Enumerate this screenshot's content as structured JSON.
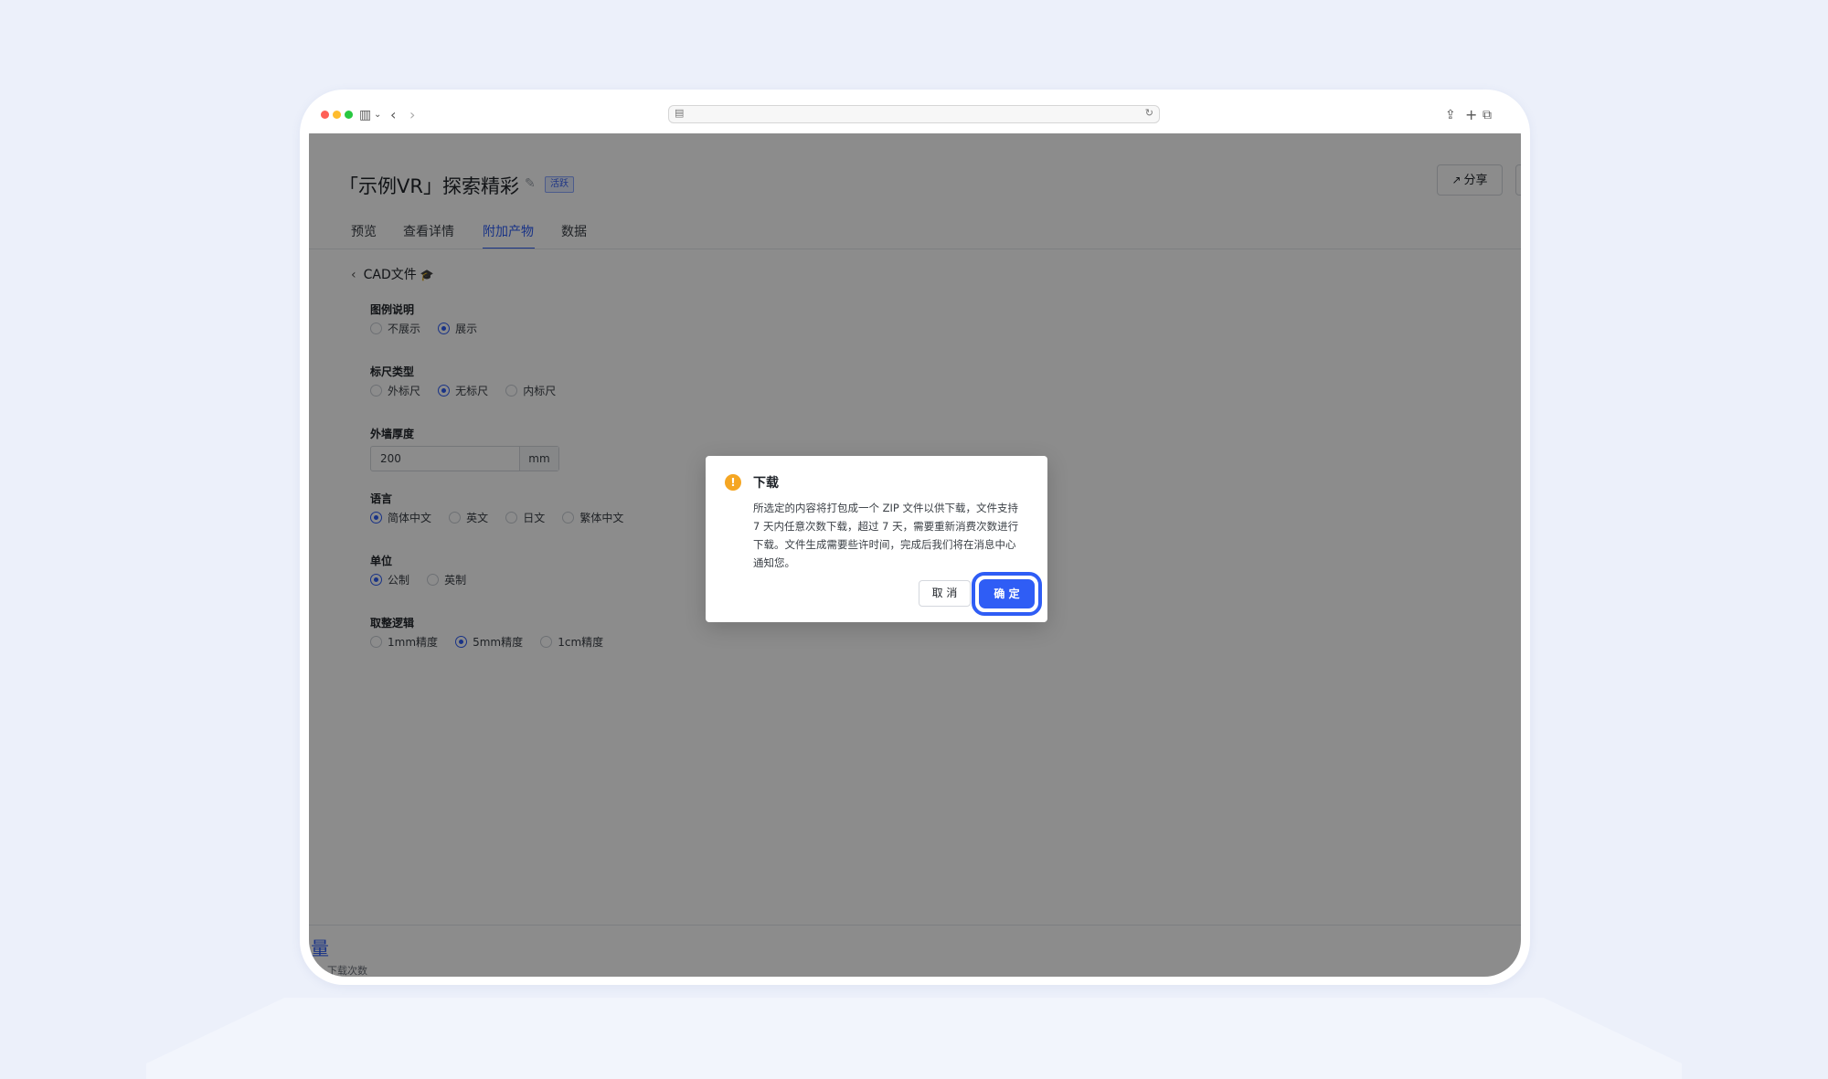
{
  "browser": {
    "url": "",
    "icons": {
      "sidebar": "sidebar-icon",
      "back": "chevron-left-icon",
      "forward": "chevron-right-icon",
      "share": "share-icon",
      "new_tab": "plus-icon",
      "tabs": "tabs-icon"
    }
  },
  "header": {
    "title": "「示例VR」探索精彩",
    "status_tag": "活跃",
    "share_label": "分享"
  },
  "tabs": [
    {
      "label": "预览",
      "active": false
    },
    {
      "label": "查看详情",
      "active": false
    },
    {
      "label": "附加产物",
      "active": true
    },
    {
      "label": "数据",
      "active": false
    }
  ],
  "section": {
    "title": "CAD文件"
  },
  "form": {
    "legend": {
      "label": "图例说明",
      "options": [
        "不展示",
        "展示"
      ],
      "selected": "展示"
    },
    "ruler": {
      "label": "标尺类型",
      "options": [
        "外标尺",
        "无标尺",
        "内标尺"
      ],
      "selected": "无标尺"
    },
    "wall": {
      "label": "外墙厚度",
      "value": "200",
      "unit": "mm"
    },
    "language": {
      "label": "语言",
      "options": [
        "简体中文",
        "英文",
        "日文",
        "繁体中文"
      ],
      "selected": "简体中文"
    },
    "unit": {
      "label": "单位",
      "options": [
        "公制",
        "英制"
      ],
      "selected": "公制"
    },
    "rounding": {
      "label": "取整逻辑",
      "options": [
        "1mm精度",
        "5mm精度",
        "1cm精度"
      ],
      "selected": "5mm精度"
    }
  },
  "footer": {
    "big_text": "量",
    "small_text": "下载次数"
  },
  "modal": {
    "title": "下载",
    "body": "所选定的内容将打包成一个 ZIP 文件以供下载，文件支持 7 天内任意次数下载，超过 7 天，需要重新消费次数进行下载。文件生成需要些许时间，完成后我们将在消息中心通知您。",
    "cancel_label": "取 消",
    "ok_label": "确 定",
    "colors": {
      "primary": "#2f5df5",
      "warning": "#f5a623"
    }
  }
}
